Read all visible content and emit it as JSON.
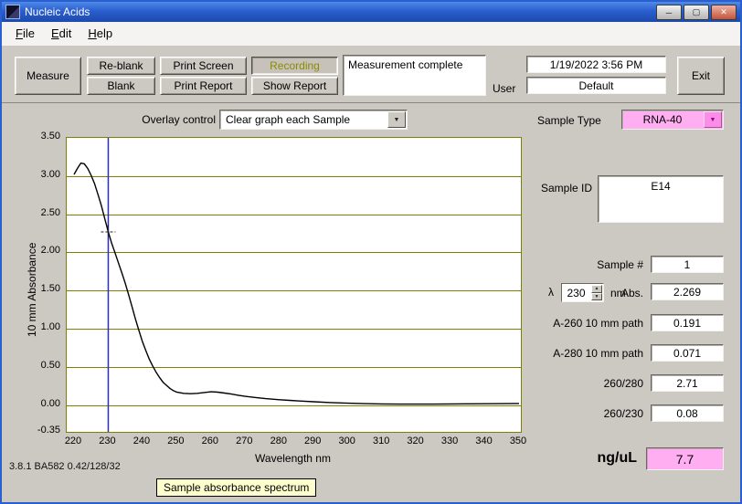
{
  "window": {
    "title": "Nucleic Acids",
    "minimize": "─",
    "maximize": "▢",
    "close": "✕"
  },
  "menu": {
    "items": [
      {
        "label": "File",
        "accel": 0
      },
      {
        "label": "Edit",
        "accel": 0
      },
      {
        "label": "Help",
        "accel": 0
      }
    ]
  },
  "toolbar": {
    "measure": "Measure",
    "reblank": "Re-blank",
    "blank": "Blank",
    "print_screen": "Print Screen",
    "print_report": "Print Report",
    "recording": "Recording",
    "show_report": "Show Report",
    "status": "Measurement complete",
    "user_label": "User",
    "datetime": "1/19/2022  3:56 PM",
    "user_value": "Default",
    "exit": "Exit"
  },
  "controls": {
    "overlay_label": "Overlay control",
    "overlay_value": "Clear graph each Sample",
    "sample_type_label": "Sample Type",
    "sample_type_value": "RNA-40",
    "dropdown_arrow": "▼",
    "spin_up": "▲",
    "spin_down": "▼"
  },
  "readings": {
    "sample_id_label": "Sample ID",
    "sample_id": "E14",
    "sample_num_label": "Sample #",
    "sample_num": "1",
    "lambda_label": "λ",
    "lambda_value": "230",
    "nm_label": "nm",
    "abs_label": "Abs.",
    "abs_value": "2.269",
    "a260_label": "A-260 10 mm path",
    "a260": "0.191",
    "a280_label": "A-280 10 mm path",
    "a280": "0.071",
    "ratio_260_280_label": "260/280",
    "ratio_260_280": "2.71",
    "ratio_260_230_label": "260/230",
    "ratio_260_230": "0.08",
    "conc_label": "ng/uL",
    "conc_value": "7.7"
  },
  "statusbar": {
    "version": "3.8.1 BA582 0.42/128/32",
    "tooltip": "Sample absorbance spectrum"
  },
  "colors": {
    "sample_type_bg": "#ffaef2",
    "conc_bg": "#ffaef2",
    "grid_olive": "#7f7f00",
    "cursor_blue": "#2a2ac8",
    "recording_text": "#8b8b00"
  },
  "chart_data": {
    "type": "line",
    "title": "Sample absorbance spectrum",
    "xlabel": "Wavelength nm",
    "ylabel": "10 mm Absorbance",
    "xlim": [
      220,
      350
    ],
    "ylim": [
      -0.35,
      3.5
    ],
    "xticks": [
      220,
      230,
      240,
      250,
      260,
      270,
      280,
      290,
      300,
      310,
      320,
      330,
      340,
      350
    ],
    "yticks": [
      3.5,
      3.0,
      2.5,
      2.0,
      1.5,
      1.0,
      0.5,
      0.0,
      -0.35
    ],
    "ytick_labels": [
      "3.50",
      "3.00",
      "2.50",
      "2.00",
      "1.50",
      "1.00",
      "0.50",
      "0.00",
      "-0.35"
    ],
    "grid": "horizontal",
    "grid_color": "#7f7f00",
    "line_color": "#000000",
    "legend": "none",
    "cursor": {
      "wavelength": 230,
      "absorbance": 2.269,
      "line_color": "#2a2ac8"
    },
    "series": [
      {
        "name": "Sample absorbance",
        "x": [
          220,
          221,
          222,
          223,
          224,
          225,
          226,
          227,
          228,
          229,
          230,
          231,
          232,
          233,
          234,
          235,
          236,
          237,
          238,
          239,
          240,
          241,
          242,
          243,
          244,
          245,
          246,
          247,
          248,
          249,
          250,
          252,
          254,
          256,
          258,
          260,
          262,
          264,
          266,
          268,
          270,
          272,
          274,
          276,
          278,
          280,
          283,
          286,
          290,
          295,
          300,
          305,
          310,
          315,
          320,
          325,
          330,
          335,
          340,
          345,
          350
        ],
        "y": [
          3.02,
          3.1,
          3.17,
          3.16,
          3.1,
          3.01,
          2.9,
          2.76,
          2.61,
          2.44,
          2.269,
          2.12,
          1.99,
          1.86,
          1.73,
          1.59,
          1.44,
          1.28,
          1.12,
          0.97,
          0.83,
          0.71,
          0.6,
          0.51,
          0.43,
          0.36,
          0.3,
          0.26,
          0.22,
          0.19,
          0.17,
          0.155,
          0.15,
          0.155,
          0.165,
          0.175,
          0.17,
          0.158,
          0.145,
          0.13,
          0.115,
          0.105,
          0.095,
          0.085,
          0.078,
          0.071,
          0.062,
          0.054,
          0.044,
          0.034,
          0.026,
          0.02,
          0.016,
          0.014,
          0.013,
          0.014,
          0.016,
          0.017,
          0.018,
          0.02,
          0.022
        ]
      }
    ]
  }
}
